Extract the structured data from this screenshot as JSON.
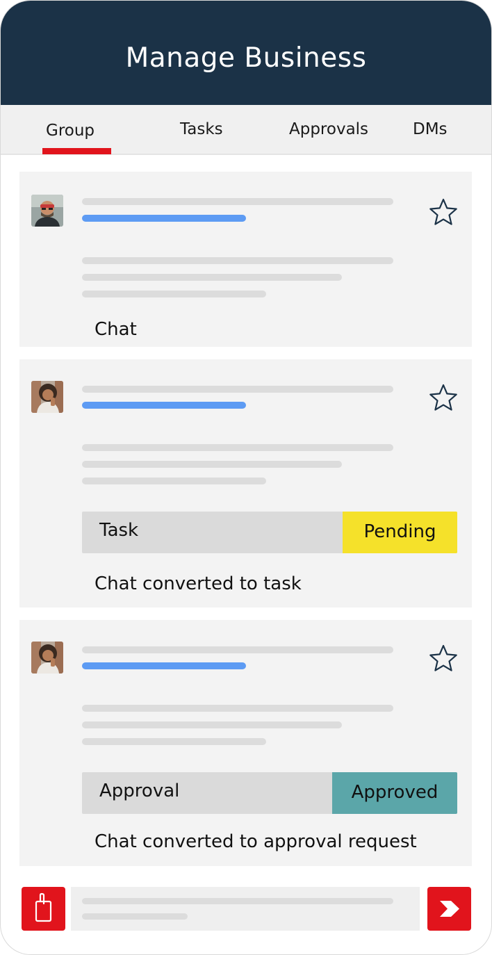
{
  "header": {
    "title": "Manage Business"
  },
  "tabs": [
    {
      "label": "Group",
      "active": true
    },
    {
      "label": "Tasks"
    },
    {
      "label": "Approvals"
    },
    {
      "label": "DMs"
    }
  ],
  "cards": [
    {
      "caption": "Chat",
      "starred": false,
      "icon": "star-outline-icon"
    },
    {
      "caption": "Chat converted to task",
      "status_label": "Task",
      "status_badge": "Pending",
      "badge_color": "#f5e12a"
    },
    {
      "caption": "Chat converted to approval request",
      "status_label": "Approval",
      "status_badge": "Approved",
      "badge_color": "#5ba6a9"
    }
  ],
  "bottom": {
    "attach_icon": "clipboard-icon",
    "send_icon": "send-arrow-icon"
  },
  "colors": {
    "header": "#1b3247",
    "accent": "#e1141c",
    "link_line": "#5d9bf3"
  }
}
